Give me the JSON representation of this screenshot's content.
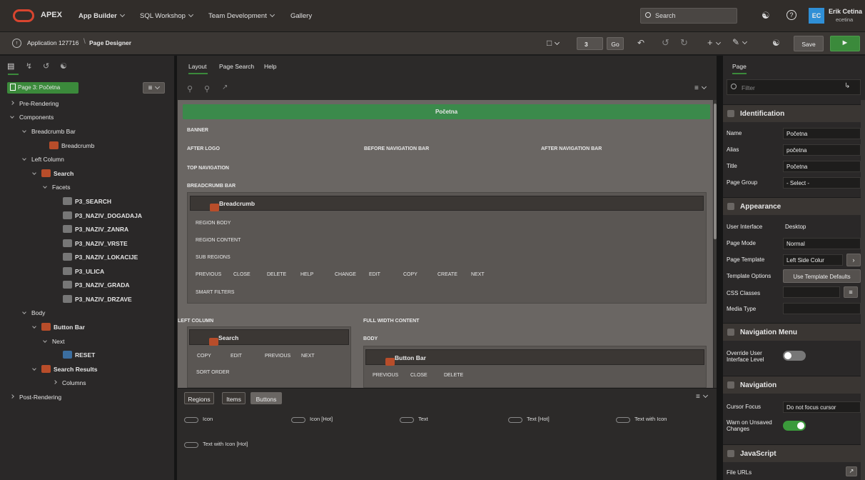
{
  "topbar": {
    "brand": "APEX",
    "nav1": "App Builder",
    "nav2": "SQL Workshop",
    "nav3": "Team Development",
    "nav4": "Gallery",
    "search_placeholder": "Search",
    "user_initials": "EC",
    "user_name": "Erik Cetina",
    "user_login": "ecetina"
  },
  "toolbar": {
    "breadcrumb_app": "Application 127716",
    "breadcrumb_page": "Page Designer",
    "page_num": "3",
    "go": "Go",
    "save": "Save"
  },
  "left": {
    "page_label": "Page 3: Početna",
    "tree": [
      "Pre-Rendering",
      "Components",
      "Breadcrumb Bar",
      "Breadcrumb",
      "Left Column",
      "Search",
      "Facets",
      "P3_SEARCH",
      "P3_NAZIV_DOGADAJA",
      "P3_NAZIV_ZANRA",
      "P3_NAZIV_VRSTE",
      "P3_NAZIV_LOKACIJE",
      "P3_ULICA",
      "P3_NAZIV_GRADA",
      "P3_NAZIV_DRZAVE",
      "Body",
      "Button Bar",
      "Next",
      "RESET",
      "Search Results",
      "Columns",
      "Post-Rendering"
    ]
  },
  "center": {
    "tabs": [
      "Layout",
      "Page Search",
      "Help"
    ],
    "page_title": "Početna",
    "banner": "BANNER",
    "after_logo": "AFTER LOGO",
    "before_nav": "BEFORE NAVIGATION BAR",
    "after_nav": "AFTER NAVIGATION BAR",
    "top_nav": "TOP NAVIGATION",
    "breadcrumb_bar": "BREADCRUMB BAR",
    "breadcrumb": "Breadcrumb",
    "region_body": "REGION BODY",
    "region_content": "REGION CONTENT",
    "sub_regions": "SUB REGIONS",
    "bc_buttons": [
      "PREVIOUS",
      "CLOSE",
      "DELETE",
      "HELP",
      "CHANGE",
      "EDIT",
      "COPY",
      "CREATE",
      "NEXT"
    ],
    "smart_filters": "SMART FILTERS",
    "left_column": "LEFT COLUMN",
    "full_width": "FULL WIDTH CONTENT",
    "search": "Search",
    "search_buttons": [
      "COPY",
      "EDIT",
      "PREVIOUS",
      "NEXT"
    ],
    "sort_order": "SORT ORDER",
    "body": "BODY",
    "button_bar": "Button Bar",
    "bb_buttons": [
      "PREVIOUS",
      "CLOSE",
      "DELETE"
    ]
  },
  "gallery": {
    "tabs": [
      "Regions",
      "Items",
      "Buttons"
    ],
    "buttons": [
      "Icon",
      "Icon [Hot]",
      "Text",
      "Text [Hot]",
      "Text with Icon",
      "Text with Icon [Hot]"
    ]
  },
  "right": {
    "tab": "Page",
    "filter_placeholder": "Filter",
    "identification": "Identification",
    "name_label": "Name",
    "name": "Početna",
    "alias_label": "Alias",
    "alias": "početna",
    "title_label": "Title",
    "title": "Početna",
    "page_group_label": "Page Group",
    "page_group": "- Select -",
    "appearance": "Appearance",
    "ui_label": "User Interface",
    "ui": "Desktop",
    "mode_label": "Page Mode",
    "mode": "Normal",
    "template_label": "Page Template",
    "template": "Left Side Colur",
    "template_opts_label": "Template Options",
    "template_opts": "Use Template Defaults",
    "css_label": "CSS Classes",
    "media_label": "Media Type",
    "navmenu": "Navigation Menu",
    "override_label1": "Override User",
    "override_label2": "Interface Level",
    "navigation": "Navigation",
    "cursor_label": "Cursor Focus",
    "cursor": "Do not focus cursor",
    "warn_label1": "Warn on Unsaved",
    "warn_label2": "Changes",
    "javascript": "JavaScript",
    "file_urls": "File URLs"
  }
}
